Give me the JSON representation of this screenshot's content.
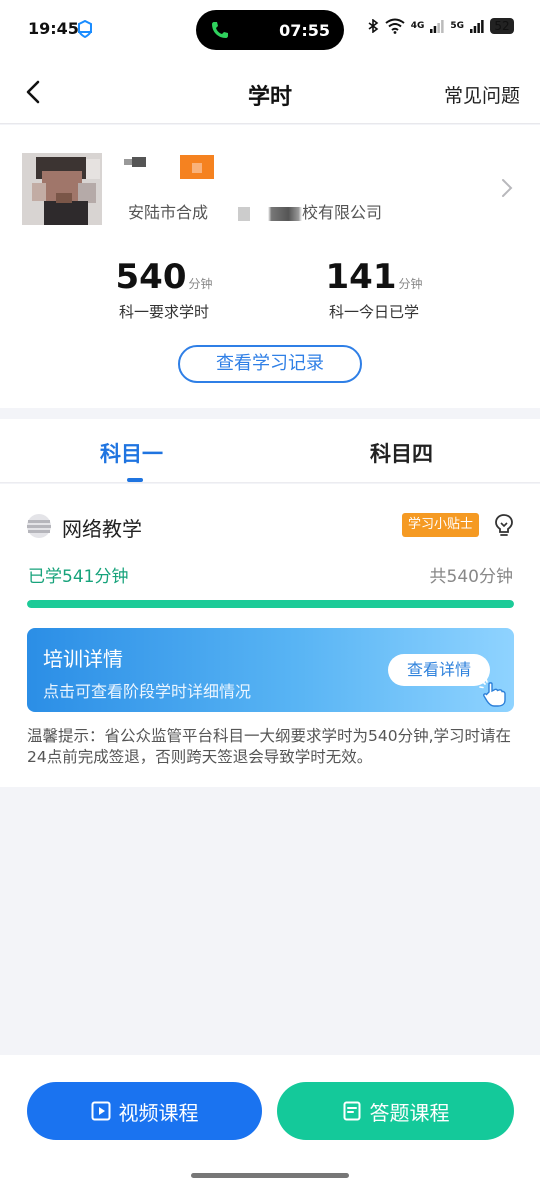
{
  "status_bar": {
    "time": "19:45",
    "call_time": "07:55",
    "network_1": "4G",
    "network_2": "5G",
    "battery": "52"
  },
  "nav": {
    "title": "学时",
    "faq_label": "常见问题"
  },
  "profile": {
    "company_prefix": "安陆市合成",
    "company_suffix": "校有限公司",
    "stats": [
      {
        "value": "540",
        "unit": "分钟",
        "label": "科一要求学时"
      },
      {
        "value": "141",
        "unit": "分钟",
        "label": "科一今日已学"
      }
    ],
    "record_button": "查看学习记录"
  },
  "tabs": [
    {
      "label": "科目一",
      "active": true
    },
    {
      "label": "科目四",
      "active": false
    }
  ],
  "course": {
    "title": "网络教学",
    "tips_badge": "学习小贴士",
    "studied": "已学541分钟",
    "total": "共540分钟",
    "progress_fraction": 1.0
  },
  "banner": {
    "title": "培训详情",
    "subtitle": "点击可查看阶段学时详细情况",
    "button": "查看详情"
  },
  "notice": "温馨提示：省公众监管平台科目一大纲要求学时为540分钟,学习时请在24点前完成签退，否则跨天签退会导致学时无效。",
  "bottom_buttons": {
    "video": "视频课程",
    "quiz": "答题课程"
  },
  "colors": {
    "accent": "#1f74e0",
    "green": "#17a37b",
    "progress": "#1ccb98",
    "tips_badge": "#f59a23",
    "video_button": "#1a73f0",
    "quiz_button": "#14c99a"
  }
}
